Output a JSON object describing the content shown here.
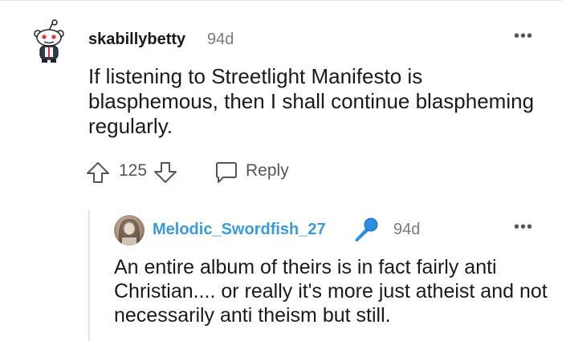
{
  "comment": {
    "username": "skabillybetty",
    "time": "94d",
    "more": "•••",
    "body": "If listening to Streetlight Manifesto is blasphemous, then I shall continue blaspheming regularly.",
    "votes": "125",
    "reply_label": "Reply"
  },
  "reply": {
    "username": "Melodic_Swordfish_27",
    "time": "94d",
    "more": "•••",
    "body": "An entire album of theirs is in fact fairly anti Christian.... or really it's more just atheist and not necessarily anti theism but still."
  },
  "icons": {
    "avatar_top": "snoo-avatar-icon",
    "upvote": "upvote-arrow-icon",
    "downvote": "downvote-arrow-icon",
    "reply": "chat-bubble-icon",
    "flair": "microphone-icon"
  },
  "colors": {
    "username_reply": "#3d9ad8",
    "meta_gray": "#787c7e",
    "mic_blue": "#2a8fe0"
  }
}
